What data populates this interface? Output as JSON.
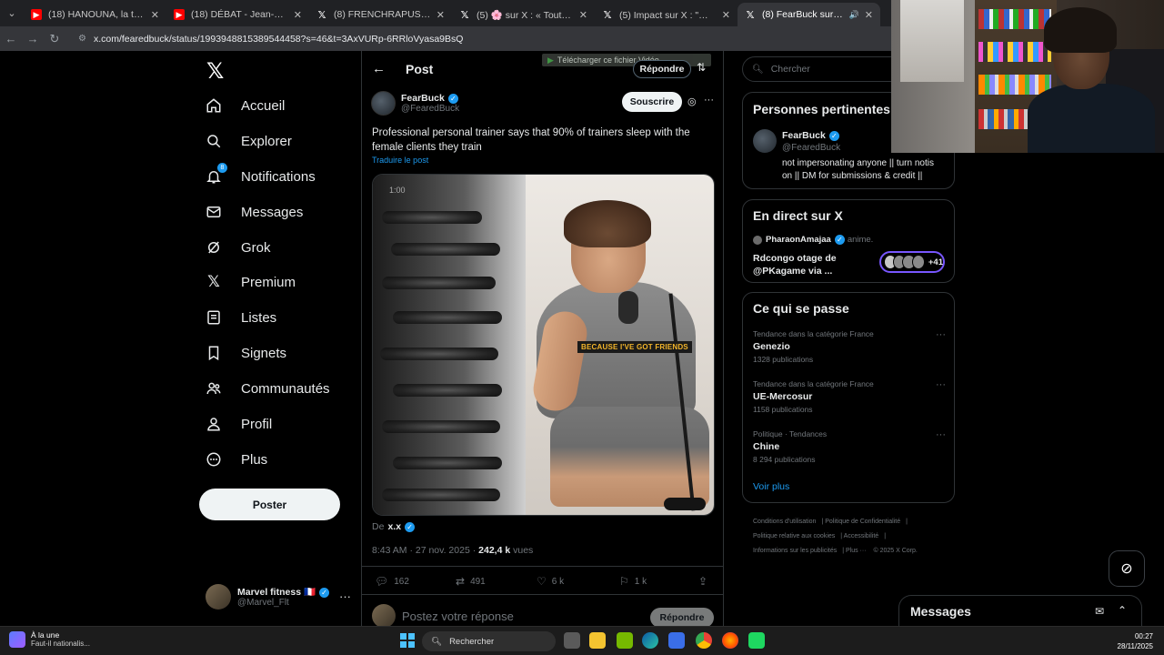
{
  "browser": {
    "tabs": [
      {
        "icon": "youtube-icon",
        "label": "(18) HANOUNA, la télé français"
      },
      {
        "icon": "youtube-icon",
        "label": "(18) DÉBAT - Jean-Luc Mélench"
      },
      {
        "icon": "x-icon",
        "label": "(8) FRENCHRAPUS us sur X : \""
      },
      {
        "icon": "x-icon",
        "label": "(5) 🌸 sur X : « Tout ça parce c"
      },
      {
        "icon": "x-icon",
        "label": "(5) Impact sur X : \"🚨🇫🇷 ALE"
      },
      {
        "icon": "x-icon",
        "label": "(8) FearBuck sur X : \"Profes"
      }
    ],
    "url": "x.com/fearedbuck/status/1993948815389544458?s=46&t=3AxVURp-6RRloVyasa9BsQ"
  },
  "nav": {
    "items": [
      {
        "label": "Accueil",
        "icon": "home-icon"
      },
      {
        "label": "Explorer",
        "icon": "search-icon"
      },
      {
        "label": "Notifications",
        "icon": "bell-icon",
        "badge": "8"
      },
      {
        "label": "Messages",
        "icon": "mail-icon"
      },
      {
        "label": "Grok",
        "icon": "grok-icon"
      },
      {
        "label": "Premium",
        "icon": "x-icon"
      },
      {
        "label": "Listes",
        "icon": "list-icon"
      },
      {
        "label": "Signets",
        "icon": "bookmark-icon"
      },
      {
        "label": "Communautés",
        "icon": "communities-icon"
      },
      {
        "label": "Profil",
        "icon": "person-icon"
      },
      {
        "label": "Plus",
        "icon": "more-circle-icon"
      }
    ],
    "post_button": "Poster"
  },
  "account": {
    "name": "Marvel fitness 🇫🇷",
    "handle": "@Marvel_Flt"
  },
  "header": {
    "title": "Post",
    "download_bar": "Télécharger ce fichier Vidéo",
    "reply_button": "Répondre"
  },
  "post": {
    "author_name": "FearBuck",
    "author_handle": "@FearedBuck",
    "subscribe": "Souscrire",
    "text": "Professional personal trainer says that 90% of trainers sleep with the female clients they train",
    "translate": "Traduire le post",
    "video_time": "1:00",
    "video_caption": "BECAUSE I'VE GOT FRIENDS",
    "from_prefix": "De",
    "from_name": "x.x",
    "time": "8:43 AM · 27 nov. 2025 ·",
    "views_count": "242,4 k",
    "views_label": "vues",
    "stats": {
      "replies": "162",
      "reposts": "491",
      "likes": "6 k",
      "bookmarks": "1 k"
    },
    "reply_placeholder": "Postez votre réponse",
    "reply_button": "Répondre"
  },
  "right": {
    "search_placeholder": "Chercher",
    "relevant": {
      "title": "Personnes pertinentes",
      "name": "FearBuck",
      "handle": "@FearedBuck",
      "bio": "not impersonating anyone || turn notis on || DM for submissions & credit ||"
    },
    "live": {
      "title": "En direct sur X",
      "host": "PharaonAmajaa",
      "host_action": "anime.",
      "topic": "Rdcongo otage de @PKagame via ...",
      "count": "+41"
    },
    "trends": {
      "title": "Ce qui se passe",
      "items": [
        {
          "category": "Tendance dans la catégorie France",
          "name": "Genezio",
          "count": "1328 publications"
        },
        {
          "category": "Tendance dans la catégorie France",
          "name": "UE-Mercosur",
          "count": "1158 publications"
        },
        {
          "category": "Politique · Tendances",
          "name": "Chine",
          "count": "8 294 publications"
        }
      ],
      "more": "Voir plus"
    },
    "footer": {
      "terms": "Conditions d'utilisation",
      "privacy": "Politique de Confidentialité",
      "cookies": "Politique relative aux cookies",
      "accessibility": "Accessibilité",
      "ads": "Informations sur les publicités",
      "more": "Plus ···",
      "copyright": "© 2025 X Corp."
    }
  },
  "messages_drawer": {
    "title": "Messages"
  },
  "taskbar": {
    "news_title": "À la une",
    "news_sub": "Faut-il nationalis...",
    "search": "Rechercher",
    "time": "00:27",
    "date": "28/11/2025"
  }
}
